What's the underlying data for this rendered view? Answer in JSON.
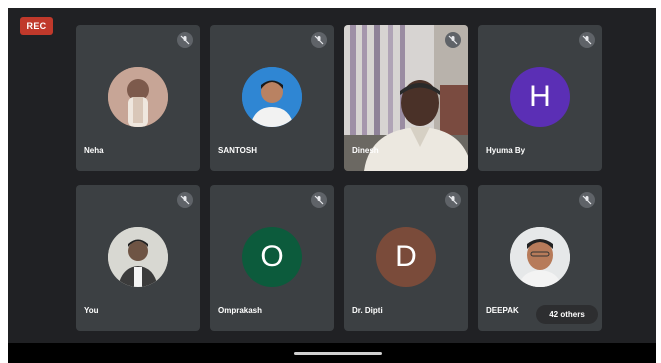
{
  "recording_badge": "REC",
  "participants": [
    {
      "name": "Neha",
      "tile": "photo",
      "avatar_bg": "#b98f7d"
    },
    {
      "name": "SANTOSH",
      "tile": "photo",
      "avatar_bg": "#2d7fc9"
    },
    {
      "name": "Dinesh",
      "tile": "video"
    },
    {
      "name": "Hyuma By",
      "tile": "letter",
      "letter": "H",
      "avatar_bg": "#5b2fb5"
    },
    {
      "name": "You",
      "tile": "photo",
      "avatar_bg": "#c9c9c4"
    },
    {
      "name": "Omprakash",
      "tile": "letter",
      "letter": "O",
      "avatar_bg": "#0c5b3c"
    },
    {
      "name": "Dr. Dipti",
      "tile": "letter",
      "letter": "D",
      "avatar_bg": "#7a4b3a"
    },
    {
      "name": "DEEPAK",
      "tile": "photo",
      "avatar_bg": "#e3e5e6"
    }
  ],
  "others_label": "42 others",
  "icons": {
    "mute": "mic-off-icon"
  }
}
